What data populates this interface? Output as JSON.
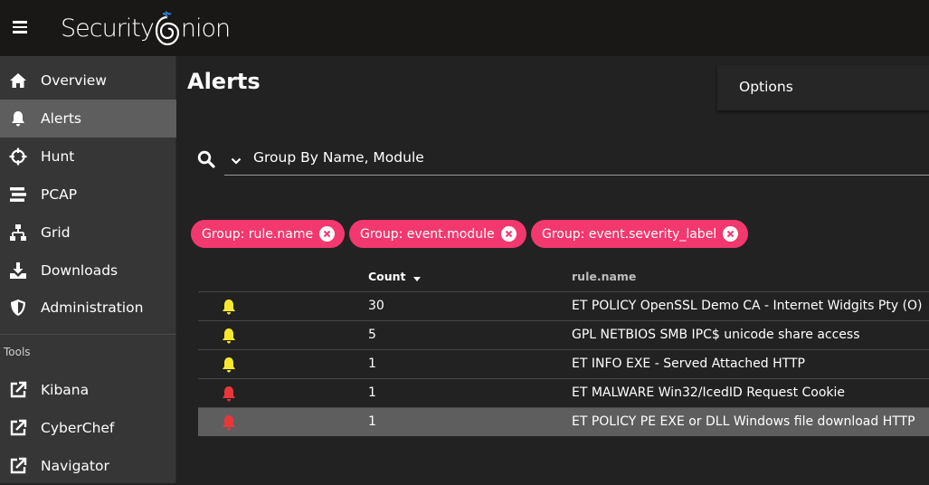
{
  "header": {
    "logo_text_1": "Security",
    "logo_text_2": "nion"
  },
  "sidebar": {
    "items": [
      {
        "label": "Overview"
      },
      {
        "label": "Alerts"
      },
      {
        "label": "Hunt"
      },
      {
        "label": "PCAP"
      },
      {
        "label": "Grid"
      },
      {
        "label": "Downloads"
      },
      {
        "label": "Administration"
      }
    ],
    "tools_label": "Tools",
    "tools": [
      {
        "label": "Kibana"
      },
      {
        "label": "CyberChef"
      },
      {
        "label": "Navigator"
      }
    ]
  },
  "main": {
    "title": "Alerts",
    "options_label": "Options",
    "query": "Group By Name, Module",
    "chips": [
      {
        "label": "Group: rule.name"
      },
      {
        "label": "Group: event.module"
      },
      {
        "label": "Group: event.severity_label"
      }
    ],
    "table": {
      "headers": {
        "count": "Count",
        "name": "rule.name"
      },
      "rows": [
        {
          "severity": "medium",
          "count": "30",
          "name": "ET POLICY OpenSSL Demo CA - Internet Widgits Pty (O)"
        },
        {
          "severity": "medium",
          "count": "5",
          "name": "GPL NETBIOS SMB IPC$ unicode share access"
        },
        {
          "severity": "medium",
          "count": "1",
          "name": "ET INFO EXE - Served Attached HTTP"
        },
        {
          "severity": "high",
          "count": "1",
          "name": "ET MALWARE Win32/IcedID Request Cookie"
        },
        {
          "severity": "high",
          "count": "1",
          "name": "ET POLICY PE EXE or DLL Windows file download HTTP"
        }
      ]
    }
  },
  "colors": {
    "accent": "#f2386f",
    "bell_medium": "#f7e82f",
    "bell_high": "#e8363b",
    "active_nav": "#5e5e5e"
  }
}
